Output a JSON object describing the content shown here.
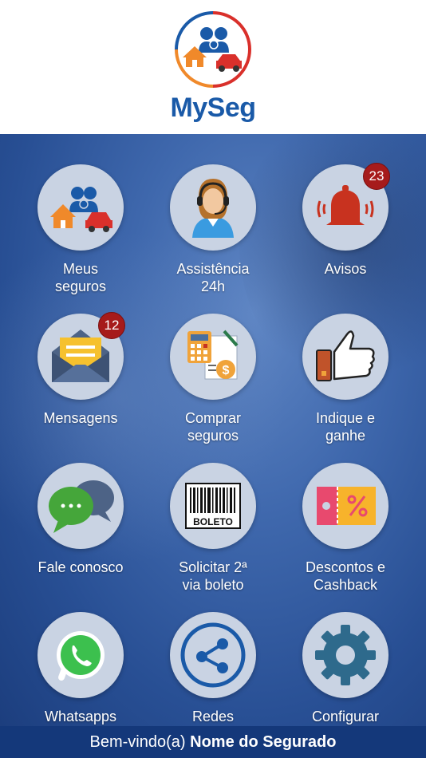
{
  "app": {
    "brand": "MySeg"
  },
  "tiles": [
    {
      "label": "Meus\nseguros",
      "icon": "family-house-car-icon"
    },
    {
      "label": "Assistência\n24h",
      "icon": "headset-agent-icon"
    },
    {
      "label": "Avisos",
      "icon": "alarm-bell-icon",
      "badge": "23"
    },
    {
      "label": "Mensagens",
      "icon": "envelope-icon",
      "badge": "12"
    },
    {
      "label": "Comprar\nseguros",
      "icon": "calculator-document-icon"
    },
    {
      "label": "Indique e\nganhe",
      "icon": "thumbs-up-icon"
    },
    {
      "label": "Fale conosco",
      "icon": "chat-bubbles-icon"
    },
    {
      "label": "Solicitar 2ª\nvia boleto",
      "icon": "barcode-boleto-icon",
      "boleto_text": "BOLETO"
    },
    {
      "label": "Descontos e\nCashback",
      "icon": "discount-coupon-icon"
    },
    {
      "label": "Whatsapps",
      "icon": "whatsapp-icon"
    },
    {
      "label": "Redes\nsociais",
      "icon": "share-icon"
    },
    {
      "label": "Configurar",
      "icon": "gear-icon"
    }
  ],
  "footer": {
    "greeting": "Bem-vindo(a)",
    "user_name": "Nome do Segurado"
  },
  "colors": {
    "primary": "#1a5aa8",
    "footer_bg": "#14387a",
    "badge": "#a61b1b",
    "icon_circle": "#c9d3e3"
  }
}
